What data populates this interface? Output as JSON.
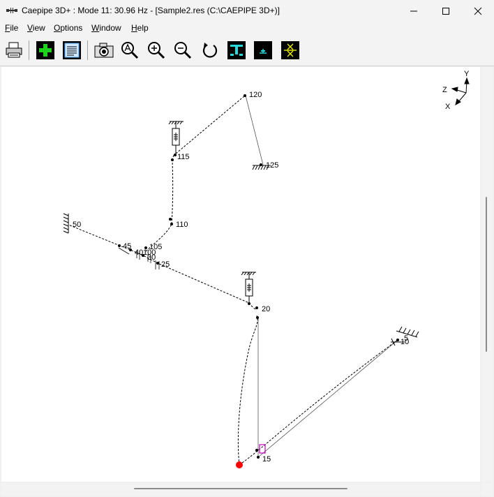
{
  "window": {
    "title": "Caepipe 3D+ : Mode 11: 30.96 Hz -  [Sample2.res (C:\\CAEPIPE 3D+)]",
    "minimize_icon": "minimize-icon",
    "maximize_icon": "maximize-icon",
    "close_icon": "close-icon"
  },
  "menu": [
    {
      "key": "F",
      "rest": "ile"
    },
    {
      "key": "V",
      "rest": "iew"
    },
    {
      "key": "O",
      "rest": "ptions"
    },
    {
      "key": "W",
      "rest": "indow"
    },
    {
      "key": "H",
      "rest": "elp"
    }
  ],
  "toolbar": [
    {
      "icon": "printer-icon"
    },
    {
      "icon": "add-plus-icon"
    },
    {
      "icon": "list-document-icon"
    },
    {
      "icon": "camera-icon"
    },
    {
      "icon": "zoom-all-icon"
    },
    {
      "icon": "zoom-in-icon"
    },
    {
      "icon": "zoom-out-icon"
    },
    {
      "icon": "rotate-icon"
    },
    {
      "icon": "beam-section-icon"
    },
    {
      "icon": "support-icon"
    },
    {
      "icon": "anchor-icon"
    }
  ],
  "axes": {
    "y": "Y",
    "z": "Z",
    "x": "X"
  },
  "nodes": {
    "n120": "120",
    "n125": "125",
    "n115": "115",
    "n110": "110",
    "n50": "50",
    "n45": "45",
    "n105": "105",
    "n40": "40",
    "n100": "100",
    "n30": "30",
    "n25": "25",
    "n20": "20",
    "n5": "5",
    "n10": "10",
    "n15": "15"
  },
  "colors": {
    "highlight_node": "#ff0000",
    "selected_element": "#c000c0"
  }
}
